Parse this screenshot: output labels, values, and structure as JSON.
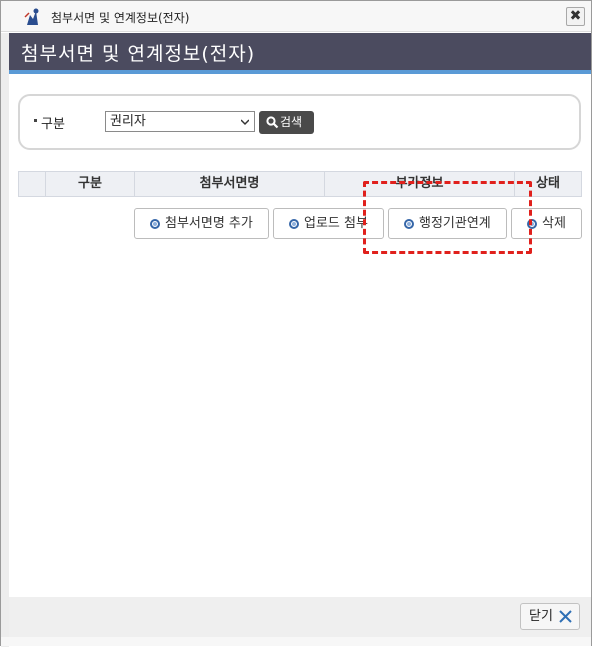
{
  "window": {
    "title": "첨부서면 및 연계정보(전자)",
    "close_label": "✖"
  },
  "header": {
    "title": "첨부서면 및 연계정보(전자)"
  },
  "search": {
    "label": "구분",
    "selected_value": "권리자",
    "button_label": "검색"
  },
  "table": {
    "headers": [
      "",
      "구분",
      "첨부서면명",
      "부가정보",
      "상태"
    ]
  },
  "actions": {
    "add_label": "첨부서면명 추가",
    "upload_label": "업로드 첨부",
    "link_label": "행정기관연계",
    "delete_label": "삭제"
  },
  "footer": {
    "close_label": "닫기"
  },
  "colors": {
    "header_band": "#4b4b5f",
    "header_accent": "#5a9ad6",
    "highlight": "#e0201c"
  },
  "icons": {
    "app": "app-logo-icon",
    "search": "search-icon",
    "close": "close-icon",
    "radio": "radio-dot-icon"
  }
}
